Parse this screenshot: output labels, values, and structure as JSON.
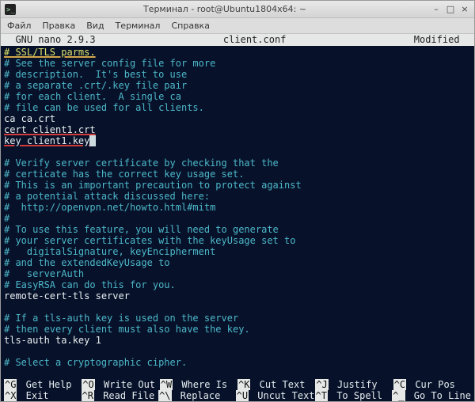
{
  "window": {
    "title": "Терминал - root@Ubuntu1804x64: ~",
    "controls": {
      "min": "–",
      "max": "□",
      "close": "×"
    }
  },
  "menubar": [
    "Файл",
    "Правка",
    "Вид",
    "Терминал",
    "Справка"
  ],
  "status": {
    "left": "  GNU nano 2.9.3",
    "center": "client.conf",
    "right": "Modified  "
  },
  "lines": [
    {
      "cls": "yu",
      "text": "# SSL/TLS parms."
    },
    {
      "cls": "c",
      "text": "# See the server config file for more"
    },
    {
      "cls": "c",
      "text": "# description.  It's best to use"
    },
    {
      "cls": "c",
      "text": "# a separate .crt/.key file pair"
    },
    {
      "cls": "c",
      "text": "# for each client.  A single ca"
    },
    {
      "cls": "c",
      "text": "# file can be used for all clients."
    },
    {
      "cls": "w",
      "text": "ca ca.crt"
    },
    {
      "seg": [
        {
          "cls": "w ru",
          "text": "cert client1.crt"
        }
      ]
    },
    {
      "seg": [
        {
          "cls": "w ru",
          "text": "key client1.key"
        },
        {
          "cls": "cursor",
          "text": " "
        }
      ]
    },
    {
      "cls": "w",
      "text": ""
    },
    {
      "cls": "c",
      "text": "# Verify server certificate by checking that the"
    },
    {
      "cls": "c",
      "text": "# certicate has the correct key usage set."
    },
    {
      "cls": "c",
      "text": "# This is an important precaution to protect against"
    },
    {
      "cls": "c",
      "text": "# a potential attack discussed here:"
    },
    {
      "cls": "c",
      "text": "#  http://openvpn.net/howto.html#mitm"
    },
    {
      "cls": "c",
      "text": "#"
    },
    {
      "cls": "c",
      "text": "# To use this feature, you will need to generate"
    },
    {
      "cls": "c",
      "text": "# your server certificates with the keyUsage set to"
    },
    {
      "cls": "c",
      "text": "#   digitalSignature, keyEncipherment"
    },
    {
      "cls": "c",
      "text": "# and the extendedKeyUsage to"
    },
    {
      "cls": "c",
      "text": "#   serverAuth"
    },
    {
      "cls": "c",
      "text": "# EasyRSA can do this for you."
    },
    {
      "cls": "w",
      "text": "remote-cert-tls server"
    },
    {
      "cls": "w",
      "text": ""
    },
    {
      "cls": "c",
      "text": "# If a tls-auth key is used on the server"
    },
    {
      "cls": "c",
      "text": "# then every client must also have the key."
    },
    {
      "cls": "w",
      "text": "tls-auth ta.key 1"
    },
    {
      "cls": "w",
      "text": ""
    },
    {
      "cls": "c",
      "text": "# Select a cryptographic cipher."
    }
  ],
  "footer": [
    [
      {
        "key": "^G",
        "label": "Get Help"
      },
      {
        "key": "^O",
        "label": "Write Out"
      },
      {
        "key": "^W",
        "label": "Where Is"
      },
      {
        "key": "^K",
        "label": "Cut Text"
      },
      {
        "key": "^J",
        "label": "Justify"
      },
      {
        "key": "^C",
        "label": "Cur Pos"
      }
    ],
    [
      {
        "key": "^X",
        "label": "Exit"
      },
      {
        "key": "^R",
        "label": "Read File"
      },
      {
        "key": "^\\",
        "label": "Replace"
      },
      {
        "key": "^U",
        "label": "Uncut Text"
      },
      {
        "key": "^T",
        "label": "To Spell"
      },
      {
        "key": "^_",
        "label": "Go To Line"
      }
    ]
  ]
}
